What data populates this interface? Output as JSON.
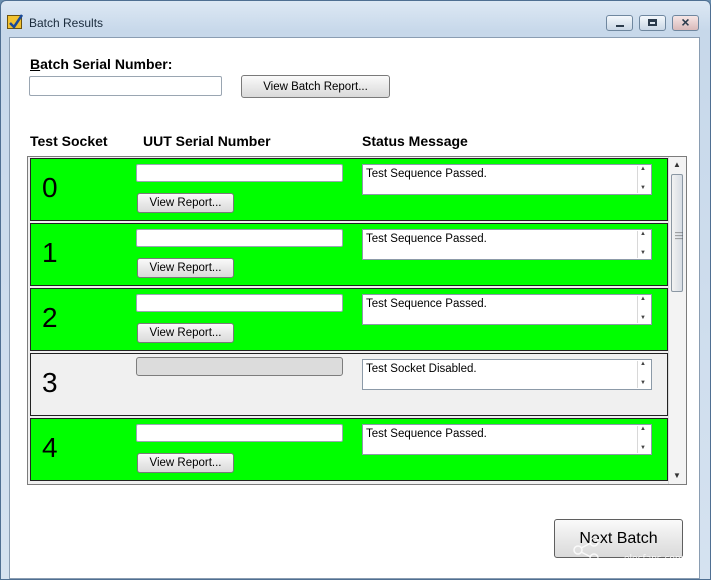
{
  "window": {
    "title": "Batch Results"
  },
  "batch": {
    "serial_label_accel": "B",
    "serial_label_rest": "atch Serial Number:",
    "serial_value": "",
    "view_batch_report": "View Batch Report..."
  },
  "headers": {
    "test_socket": "Test Socket",
    "uut_serial": "UUT Serial Number",
    "status_message": "Status Message"
  },
  "sockets": [
    {
      "number": "0",
      "serial": "",
      "button": "View Report...",
      "status": "Test Sequence Passed.",
      "state": "passed"
    },
    {
      "number": "1",
      "serial": "",
      "button": "View Report...",
      "status": "Test Sequence Passed.",
      "state": "passed"
    },
    {
      "number": "2",
      "serial": "",
      "button": "View Report...",
      "status": "Test Sequence Passed.",
      "state": "passed"
    },
    {
      "number": "3",
      "serial": "",
      "button": "",
      "status": "Test Socket Disabled.",
      "state": "disabled"
    },
    {
      "number": "4",
      "serial": "",
      "button": "View Report...",
      "status": "Test Sequence Passed.",
      "state": "passed"
    }
  ],
  "next_batch": "Next Batch",
  "colors": {
    "passed": "#00ff00",
    "disabled": "#f0f0f0",
    "window_frame": "#c7d8ea"
  },
  "icons": {
    "app": "checkbox-check-icon",
    "minimize": "minimize-icon",
    "maximize": "maximize-icon",
    "close": "close-icon"
  },
  "watermark": {
    "text": "elecfans.com"
  }
}
